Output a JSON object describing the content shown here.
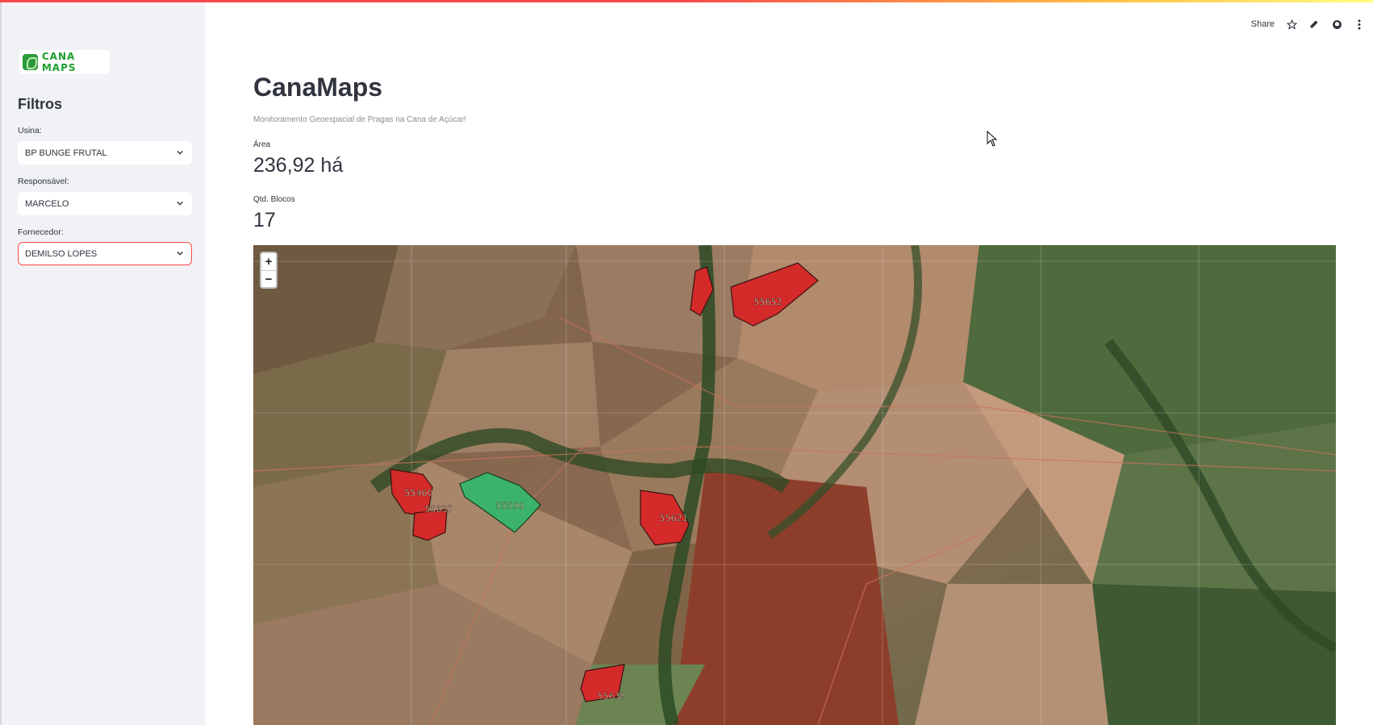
{
  "sidebar": {
    "logo_text": "CANA MAPS",
    "title": "Filtros",
    "filters": [
      {
        "label": "Usina:",
        "value": "BP BUNGE FRUTAL"
      },
      {
        "label": "Responsável:",
        "value": "MARCELO"
      },
      {
        "label": "Fornecedor:",
        "value": "DEMILSO LOPES"
      }
    ]
  },
  "header": {
    "share_label": "Share",
    "icons": [
      "star-icon",
      "edit-icon",
      "github-icon",
      "more-vertical-icon"
    ]
  },
  "main": {
    "title": "CanaMaps",
    "subtitle": "Monitoramento Geoespacial de Pragas na Cana de Açúcar!",
    "metrics": [
      {
        "label": "Área",
        "value": "236,92 há"
      },
      {
        "label": "Qtd. Blocos",
        "value": "17"
      }
    ]
  },
  "map": {
    "zoom_in": "+",
    "zoom_out": "−",
    "blocks": [
      {
        "id": "55460",
        "status": "red"
      },
      {
        "id": "55637",
        "status": "red"
      },
      {
        "id": "55599",
        "status": "green"
      },
      {
        "id": "55621",
        "status": "red"
      },
      {
        "id": "55652",
        "status": "red"
      },
      {
        "id": "55638",
        "status": "red"
      }
    ]
  },
  "colors": {
    "accent": "#ff4b4b",
    "block_red": "#d42a2a",
    "block_green": "#3cb36b",
    "sidebar_bg": "#f0f2f6"
  }
}
